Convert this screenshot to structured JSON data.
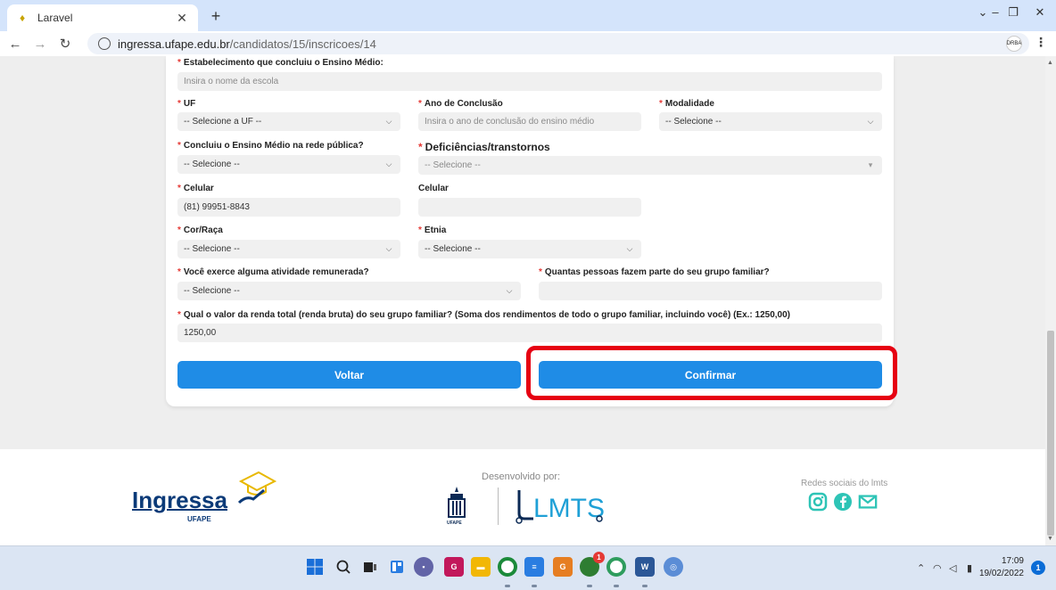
{
  "browser": {
    "tab_title": "Laravel",
    "url_host": "ingressa.ufape.edu.br",
    "url_path": "/candidatos/15/inscricoes/14",
    "profile_label": "DRBA"
  },
  "form": {
    "school": {
      "label": "Estabelecimento que concluiu o Ensino Médio:",
      "placeholder": "Insira o nome da escola"
    },
    "uf": {
      "label": "UF",
      "value": "-- Selecione a UF --"
    },
    "ano": {
      "label": "Ano de Conclusão",
      "placeholder": "Insira o ano de conclusão do ensino médio"
    },
    "modalidade": {
      "label": "Modalidade",
      "value": "-- Selecione --"
    },
    "rede_publica": {
      "label": "Concluiu o Ensino Médio na rede pública?",
      "value": "-- Selecione --"
    },
    "deficiencias": {
      "label": "Deficiências/transtornos",
      "value": "-- Selecione --"
    },
    "celular1": {
      "label": "Celular",
      "value": "(81) 99951-8843"
    },
    "celular2": {
      "label": "Celular",
      "value": ""
    },
    "cor_raca": {
      "label": "Cor/Raça",
      "value": "-- Selecione --"
    },
    "etnia": {
      "label": "Etnia",
      "value": "-- Selecione --"
    },
    "atividade": {
      "label": "Você exerce alguma atividade remunerada?",
      "value": "-- Selecione --"
    },
    "grupo_familiar": {
      "label": "Quantas pessoas fazem parte do seu grupo familiar?",
      "value": ""
    },
    "renda": {
      "label": "Qual o valor da renda total (renda bruta) do seu grupo familiar? (Soma dos rendimentos de todo o grupo familiar, incluindo você) (Ex.: 1250,00)",
      "value": "1250,00"
    },
    "back_label": "Voltar",
    "confirm_label": "Confirmar"
  },
  "footer": {
    "dev_label": "Desenvolvido por:",
    "social_label": "Redes sociais do lmts",
    "logo_word": "Ingressa",
    "logo_sub": "UFAPE",
    "lmts_text": "LMTS",
    "ufape_small": "UFAPE"
  },
  "taskbar": {
    "time": "17:09",
    "date": "19/02/2022",
    "notif_count": "1",
    "badge_count": "1"
  },
  "colors": {
    "primary": "#1f8ce6",
    "highlight": "#e60012",
    "required": "#e53935",
    "brand_navy": "#0b3a78"
  }
}
